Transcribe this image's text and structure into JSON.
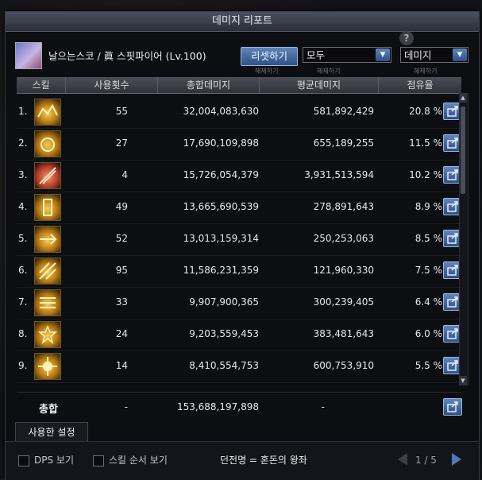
{
  "window": {
    "title": "데미지 리포트"
  },
  "character": {
    "name": "날으는스코 / 眞 스핏파이어 (Lv.100)"
  },
  "controls": {
    "reset_label": "리셋하기",
    "reset_sublabel": "해제하기",
    "filter_select": "모두",
    "filter_sublabel": "해제하기",
    "metric_select": "데미지",
    "metric_sublabel": "해제하기"
  },
  "table": {
    "headers": [
      "스킬",
      "사용횟수",
      "총합데미지",
      "평균데미지",
      "점유율"
    ],
    "rows": [
      {
        "rank": "1.",
        "uses": "55",
        "total": "32,004,083,630",
        "avg": "581,892,429",
        "share": "20.8 %"
      },
      {
        "rank": "2.",
        "uses": "27",
        "total": "17,690,109,898",
        "avg": "655,189,255",
        "share": "11.5 %"
      },
      {
        "rank": "3.",
        "uses": "4",
        "total": "15,726,054,379",
        "avg": "3,931,513,594",
        "share": "10.2 %"
      },
      {
        "rank": "4.",
        "uses": "49",
        "total": "13,665,690,539",
        "avg": "278,891,643",
        "share": "8.9 %"
      },
      {
        "rank": "5.",
        "uses": "52",
        "total": "13,013,159,314",
        "avg": "250,253,063",
        "share": "8.5 %"
      },
      {
        "rank": "6.",
        "uses": "95",
        "total": "11,586,231,359",
        "avg": "121,960,330",
        "share": "7.5 %"
      },
      {
        "rank": "7.",
        "uses": "33",
        "total": "9,907,900,365",
        "avg": "300,239,405",
        "share": "6.4 %"
      },
      {
        "rank": "8.",
        "uses": "24",
        "total": "9,203,559,453",
        "avg": "383,481,643",
        "share": "6.0 %"
      },
      {
        "rank": "9.",
        "uses": "14",
        "total": "8,410,554,753",
        "avg": "600,753,910",
        "share": "5.5 %"
      }
    ],
    "total": {
      "label": "총합",
      "uses": "-",
      "total": "153,688,197,898",
      "avg": "-"
    }
  },
  "tabs": {
    "used_settings": "사용한 설정"
  },
  "footer": {
    "dps_view": "DPS 보기",
    "skill_order_view": "스킬 순서 보기",
    "dungeon": "던전명 = 혼돈의 왕좌",
    "page": "1 / 5"
  }
}
